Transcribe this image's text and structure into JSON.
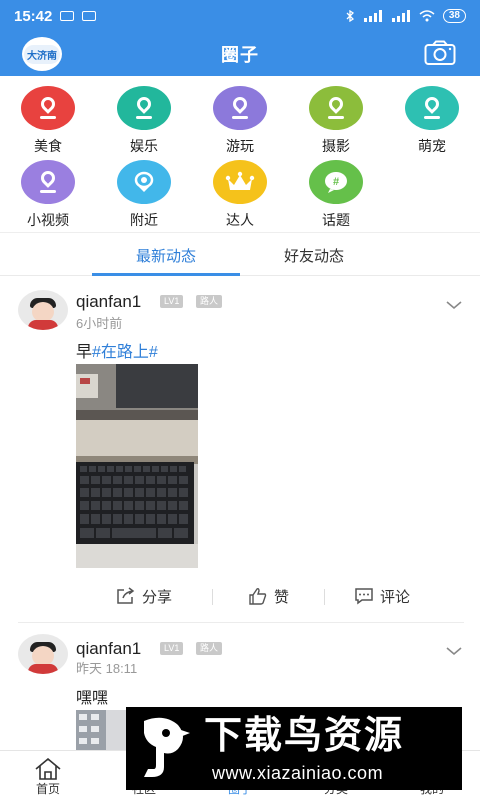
{
  "status_bar": {
    "time": "15:42",
    "battery": "38"
  },
  "header": {
    "logo_text": "大济南",
    "title": "圈子"
  },
  "categories": [
    {
      "label": "美食",
      "color": "#e8423f"
    },
    {
      "label": "娱乐",
      "color": "#22b79c"
    },
    {
      "label": "游玩",
      "color": "#8c79db"
    },
    {
      "label": "摄影",
      "color": "#8cbd3b"
    },
    {
      "label": "萌宠",
      "color": "#2ec0b2"
    },
    {
      "label": "小视频",
      "color": "#9a7fe0"
    },
    {
      "label": "附近",
      "color": "#42b7ea"
    },
    {
      "label": "达人",
      "color": "#f5c21b"
    },
    {
      "label": "话题",
      "color": "#65c04a"
    }
  ],
  "tabs": [
    {
      "label": "最新动态"
    },
    {
      "label": "好友动态"
    }
  ],
  "posts": [
    {
      "username": "qianfan1",
      "level": "LV1",
      "rank": "路人",
      "time": "6小时前",
      "text": "早",
      "tag": "#在路上#",
      "actions": {
        "share": "分享",
        "like": "赞",
        "comment": "评论"
      }
    },
    {
      "username": "qianfan1",
      "level": "LV1",
      "rank": "路人",
      "time": "昨天 18:11",
      "text": "嘿嘿"
    }
  ],
  "bottom_nav": [
    {
      "label": "首页"
    },
    {
      "label": "社区"
    },
    {
      "label": "圈子"
    },
    {
      "label": "分类"
    },
    {
      "label": "我的"
    }
  ],
  "watermark": {
    "title": "下载鸟资源",
    "url": "www.xiazainiao.com"
  },
  "colors": {
    "primary": "#3a8ee6",
    "tag": "#2f7fd8"
  }
}
